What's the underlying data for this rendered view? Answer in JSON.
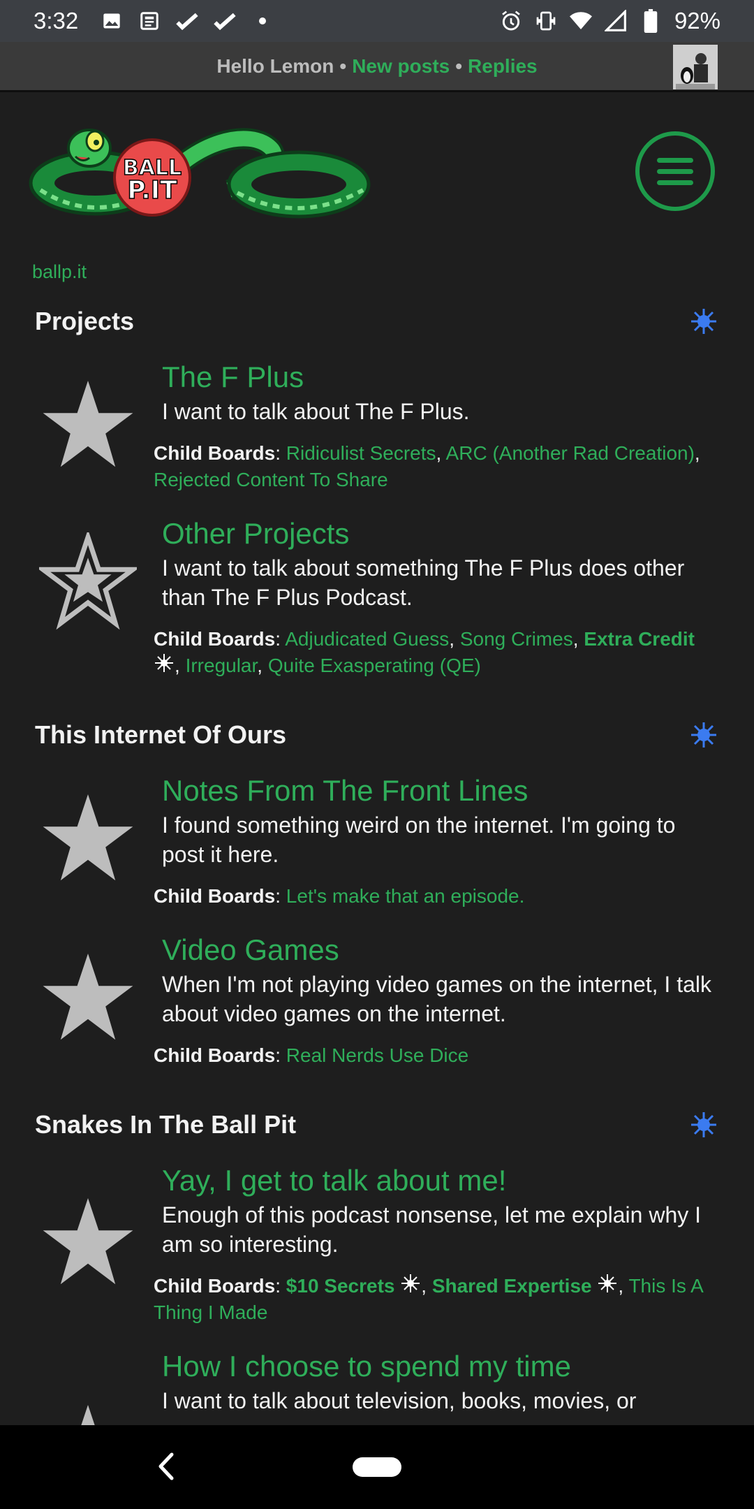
{
  "status_bar": {
    "time": "3:32",
    "battery": "92%",
    "icons_left": [
      "image-icon",
      "news-icon",
      "check-icon",
      "check-icon",
      "dot-icon"
    ],
    "icons_right": [
      "alarm-icon",
      "vibrate-icon",
      "wifi-icon",
      "signal-icon",
      "battery-icon"
    ]
  },
  "topbar": {
    "greeting": "Hello Lemon",
    "separator": "•",
    "new_posts": "New posts",
    "replies": "Replies"
  },
  "breadcrumb": "ballp.it",
  "colors": {
    "accent_green": "#2fae5a",
    "dark_green": "#1e9a4a",
    "background": "#1e1e1e",
    "star_gray": "#bdbdbd",
    "collapse_blue": "#3b7bf0"
  },
  "categories": [
    {
      "title": "Projects",
      "boards": [
        {
          "title": "The F Plus",
          "description": "I want to talk about The F Plus.",
          "icon": "star-filled-icon",
          "child_label": "Child Boards",
          "children": [
            "Ridiculist Secrets",
            "ARC (Another Rad Creation)",
            "Rejected Content To Share"
          ]
        },
        {
          "title": "Other Projects",
          "description": "I want to talk about something The F Plus does other than The F Plus Podcast.",
          "icon": "star-outline-icon",
          "child_label": "Child Boards",
          "children": [
            "Adjudicated Guess",
            "Song Crimes",
            "Extra Credit",
            "Irregular",
            "Quite Exasperating (QE)"
          ]
        }
      ]
    },
    {
      "title": "This Internet Of Ours",
      "boards": [
        {
          "title": "Notes From The Front Lines",
          "description": "I found something weird on the internet. I'm going to post it here.",
          "icon": "star-filled-icon",
          "child_label": "Child Boards",
          "children": [
            "Let's make that an episode."
          ]
        },
        {
          "title": "Video Games",
          "description": "When I'm not playing video games on the internet, I talk about video games on the internet.",
          "icon": "star-filled-icon",
          "child_label": "Child Boards",
          "children": [
            "Real Nerds Use Dice"
          ]
        }
      ]
    },
    {
      "title": "Snakes In The Ball Pit",
      "boards": [
        {
          "title": "Yay, I get to talk about me!",
          "description": "Enough of this podcast nonsense, let me explain why I am so interesting.",
          "icon": "star-filled-icon",
          "child_label": "Child Boards",
          "children": [
            "$10 Secrets",
            "Shared Expertise",
            "This Is A Thing I Made"
          ]
        },
        {
          "title": "How I choose to spend my time",
          "description": "I want to talk about television, books, movies, or",
          "icon": "star-filled-icon"
        }
      ]
    }
  ]
}
